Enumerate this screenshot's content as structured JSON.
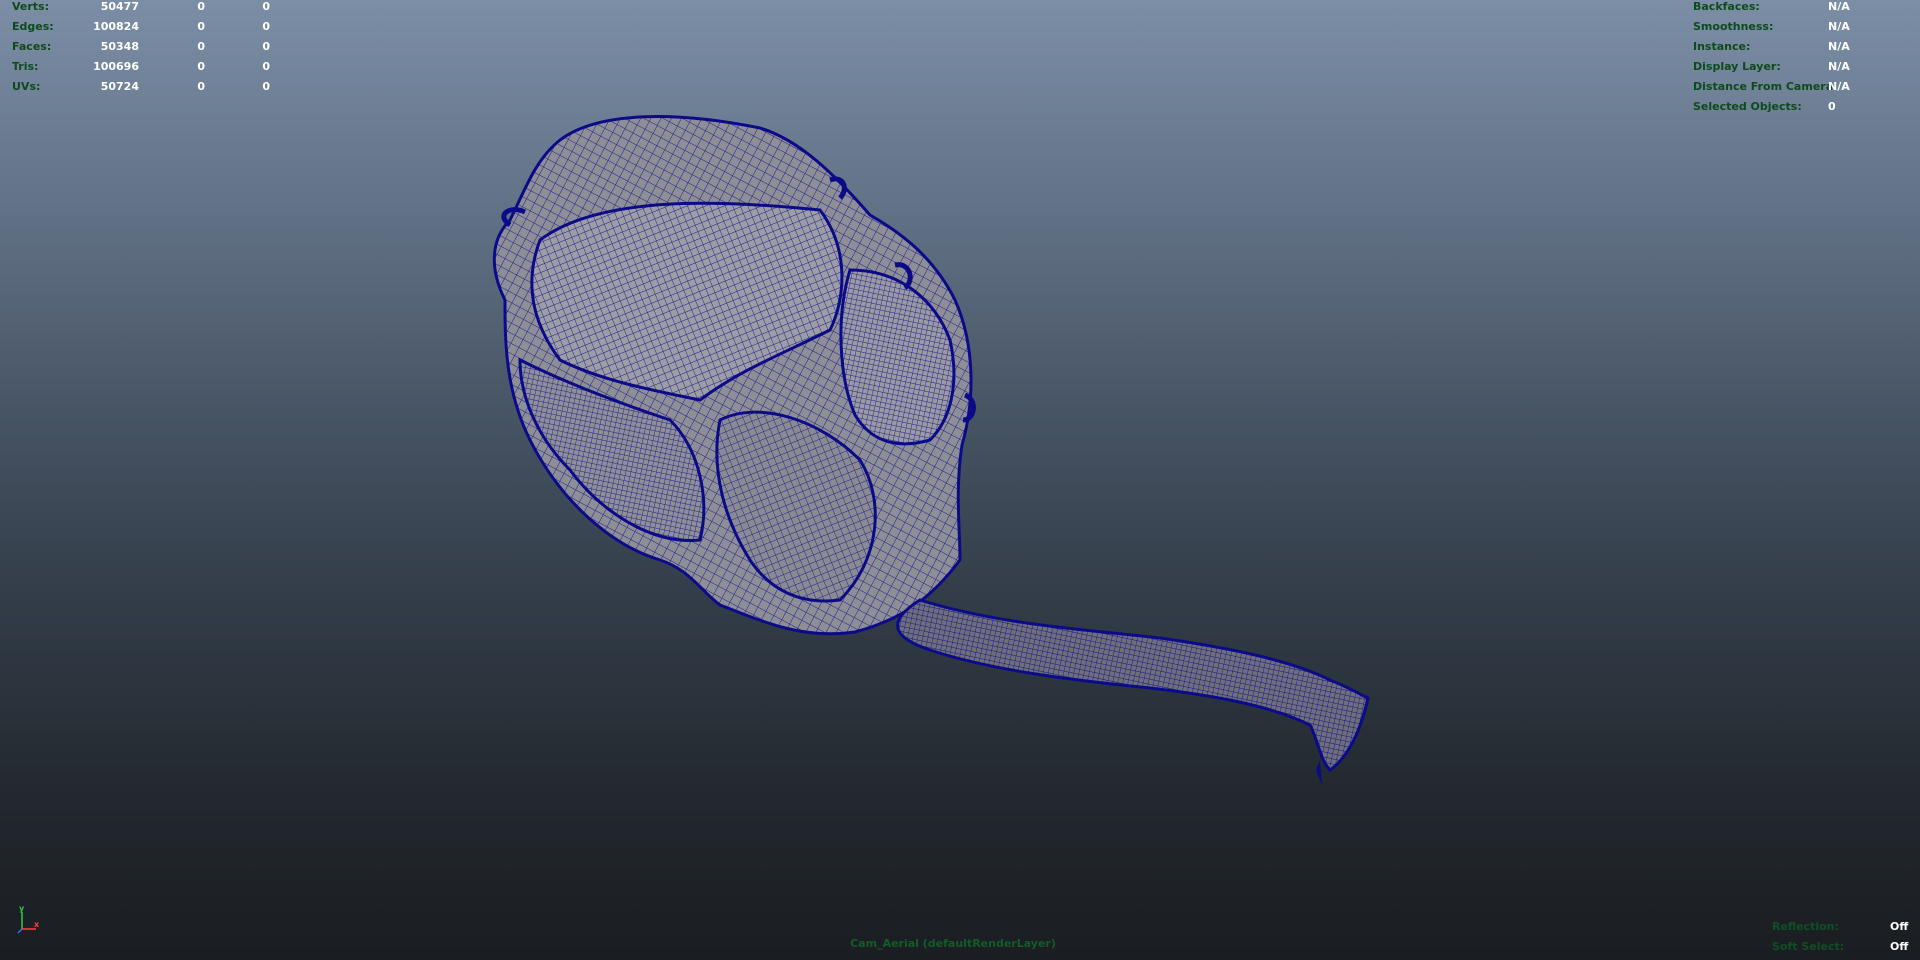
{
  "viewport": {
    "background_top": "#7c8ea6",
    "background_bottom": "#1a1d21",
    "wireframe_color": "#0b0b8a",
    "camera_label": "Cam_Aerial (defaultRenderLayer)"
  },
  "poly_stats": [
    {
      "label": "Verts:",
      "values": [
        "50477",
        "0",
        "0"
      ]
    },
    {
      "label": "Edges:",
      "values": [
        "100824",
        "0",
        "0"
      ]
    },
    {
      "label": "Faces:",
      "values": [
        "50348",
        "0",
        "0"
      ]
    },
    {
      "label": "Tris:",
      "values": [
        "100696",
        "0",
        "0"
      ]
    },
    {
      "label": "UVs:",
      "values": [
        "50724",
        "0",
        "0"
      ]
    }
  ],
  "object_details": [
    {
      "label": "Backfaces:",
      "value": "N/A"
    },
    {
      "label": "Smoothness:",
      "value": "N/A"
    },
    {
      "label": "Instance:",
      "value": "N/A"
    },
    {
      "label": "Display Layer:",
      "value": "N/A"
    },
    {
      "label": "Distance From Camera:",
      "value": "N/A"
    },
    {
      "label": "Selected Objects:",
      "value": "0"
    }
  ],
  "viewport_status": [
    {
      "label": "Reflection:",
      "value": "Off"
    },
    {
      "label": "Soft Select:",
      "value": "Off"
    }
  ],
  "axis_gizmo": {
    "y_label": "y",
    "x_label": "x"
  }
}
